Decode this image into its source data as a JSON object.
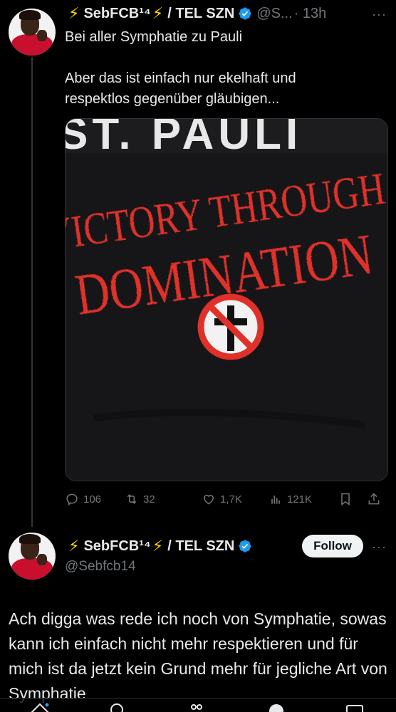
{
  "tweet1": {
    "author_prefix": "⚡",
    "author_name": "SebFCB¹⁴",
    "author_mid": "⚡",
    "author_suffix": "/ TEL SZN",
    "handle_truncated": "@S...",
    "time": "· 13h",
    "more": "···",
    "text_line1": "Bei aller Symphatie zu Pauli",
    "text_line2": "Aber das ist einfach nur ekelhaft und",
    "text_line3": "respektlos gegenüber gläubigen...",
    "image_text": {
      "top": "ST. PAULI",
      "line1": "VICTORY THROUGH",
      "line2": "DOMINATION"
    },
    "actions": {
      "replies": "106",
      "reposts": "32",
      "likes": "1,7K",
      "views": "121K"
    }
  },
  "tweet2": {
    "author_prefix": "⚡",
    "author_name": "SebFCB¹⁴",
    "author_mid": "⚡",
    "author_suffix": "/ TEL SZN",
    "handle": "@Sebfcb14",
    "follow_label": "Follow",
    "more": "···",
    "text": "Ach digga was rede ich noch von Symphatie, sowas kann ich einfach nicht mehr respektieren und für mich ist da jetzt kein Grund mehr für jegliche Art von Symphatie"
  },
  "colors": {
    "background": "#000000",
    "text": "#e7e9ea",
    "muted": "#71767b",
    "verified": "#1d9bf0",
    "bolt": "#ffd400",
    "shirt_red": "#e0302a"
  },
  "icons": {
    "reply": "reply-icon",
    "repost": "repost-icon",
    "like": "heart-icon",
    "views": "views-icon",
    "bookmark": "bookmark-icon",
    "share": "share-icon"
  }
}
